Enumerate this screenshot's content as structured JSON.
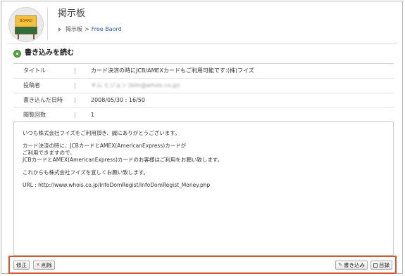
{
  "header": {
    "title": "掲示板",
    "icon_label": "BOARD",
    "breadcrumb": {
      "parent": "掲示板",
      "separator": ">",
      "current": "Free Baord"
    }
  },
  "section": {
    "title": "書き込みを読む"
  },
  "info": {
    "separator": "|",
    "rows": [
      {
        "label": "タイトル",
        "value": "カード決済の時にJCB/AMEXカードもご利用可能です:(株)フイズ"
      },
      {
        "label": "投稿者",
        "value": "キム ヒジョン (kim@whois.co.jp)"
      },
      {
        "label": "書き込んだ日時",
        "value": "2008/05/30 : 16/50"
      },
      {
        "label": "閲覧回数",
        "value": "1"
      }
    ]
  },
  "body": {
    "lines": [
      "いつも株式会社フイズをご利用頂き、誠にありがとうございます。",
      "カード決済の時に、JCBカードとAMEX(AmericanExpress)カードが",
      "ご利用できますので、",
      "JCBカードとAMEX(AmericanExpress)カードのお客様はご利用をお願い致します。",
      "これからも株式会社フイズを宜しくお願い致します。",
      "URL : http://www.whois.co.jp/InfoDomRegist/InfoDomRegist_Money.php"
    ]
  },
  "actions": {
    "edit": "修正",
    "delete": "削除",
    "write": "書き込み",
    "list": "目録"
  },
  "colors": {
    "action_bar_border": "#e0542b",
    "link": "#2a62b0",
    "section_icon": "#57a840"
  }
}
